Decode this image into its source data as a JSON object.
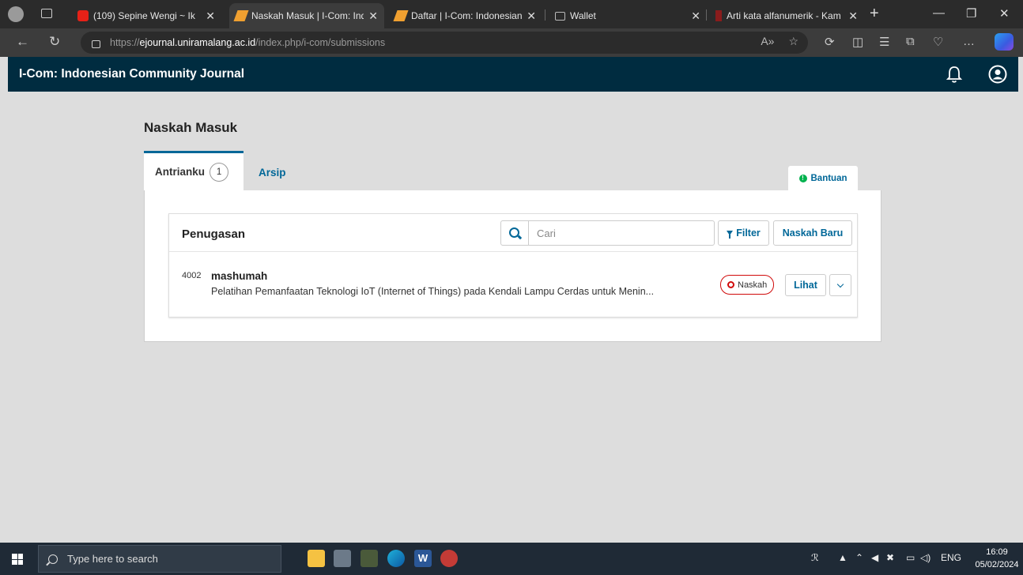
{
  "browser": {
    "tabs": [
      {
        "label": "(109) Sepine Wengi ~ Ik",
        "active": false
      },
      {
        "label": "Naskah Masuk | I-Com: Indo",
        "active": true
      },
      {
        "label": "Daftar | I-Com: Indonesian C",
        "active": false
      },
      {
        "label": "Wallet",
        "active": false
      },
      {
        "label": "Arti kata alfanumerik - Kam",
        "active": false
      }
    ],
    "new_tab": "+",
    "url_prefix": "https://",
    "url_host": "ejournal.uniramalang.ac.id",
    "url_path": "/index.php/i-com/submissions"
  },
  "app": {
    "journal_title": "I-Com: Indonesian Community Journal",
    "page_title": "Naskah Masuk",
    "tabs": {
      "my_queue_label": "Antrianku",
      "my_queue_count": "1",
      "archive_label": "Arsip"
    },
    "help_label": "Bantuan",
    "list": {
      "title": "Penugasan",
      "search_placeholder": "Cari",
      "filter_label": "Filter",
      "new_submission_label": "Naskah Baru",
      "items": [
        {
          "id": "4002",
          "author": "mashumah",
          "title": "Pelatihan Pemanfaatan Teknologi IoT (Internet of Things) pada Kendali Lampu Cerdas untuk Menin...",
          "stage": "Naskah",
          "view_label": "Lihat"
        }
      ]
    }
  },
  "taskbar": {
    "search_placeholder": "Type here to search",
    "lang": "ENG",
    "time": "16:09",
    "date": "05/02/2024"
  },
  "colors": {
    "appbar": "#002c40",
    "accent": "#006798",
    "stage_red": "#d00a0a"
  }
}
